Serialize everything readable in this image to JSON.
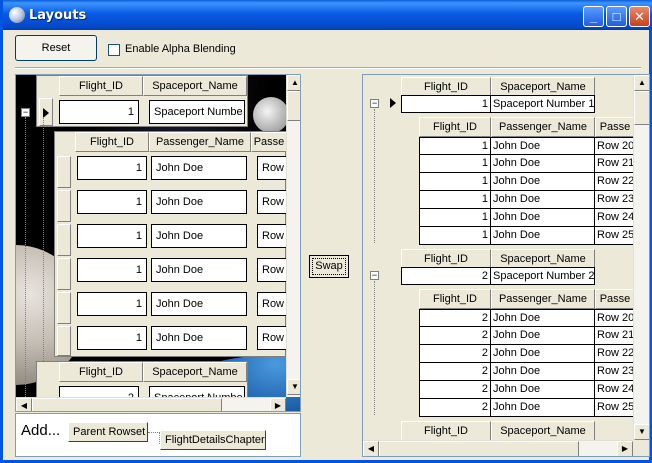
{
  "window": {
    "title": "Layouts",
    "minimize": "_",
    "maximize": "□",
    "close": "✕"
  },
  "toolbar": {
    "reset_label": "Reset",
    "alpha_label": "Enable Alpha Blending",
    "alpha_checked": false
  },
  "swap_label": "Swap",
  "add_area": {
    "label": "Add...",
    "parent_rowset": "Parent Rowset",
    "chapter": "FlightDetailsChapter"
  },
  "left": {
    "parent_headers": [
      "Flight_ID",
      "Spaceport_Name"
    ],
    "parent_row": {
      "flight_id": "1",
      "spaceport": "Spaceport Numbe"
    },
    "child_headers": [
      "Flight_ID",
      "Passenger_Name",
      "Passe"
    ],
    "child_rows": [
      {
        "flight_id": "1",
        "name": "John Doe",
        "row": "Row"
      },
      {
        "flight_id": "1",
        "name": "John Doe",
        "row": "Row"
      },
      {
        "flight_id": "1",
        "name": "John Doe",
        "row": "Row"
      },
      {
        "flight_id": "1",
        "name": "John Doe",
        "row": "Row"
      },
      {
        "flight_id": "1",
        "name": "John Doe",
        "row": "Row"
      },
      {
        "flight_id": "1",
        "name": "John Doe",
        "row": "Row"
      }
    ],
    "parent2_headers": [
      "Flight_ID",
      "Spaceport_Name"
    ],
    "parent2_row": {
      "flight_id": "2",
      "spaceport": "Spaceport Numbe"
    }
  },
  "right": {
    "group1": {
      "headers": [
        "Flight_ID",
        "Spaceport_Name"
      ],
      "row": {
        "flight_id": "1",
        "spaceport": "Spaceport Number 1"
      },
      "child_headers": [
        "Flight_ID",
        "Passenger_Name",
        "Passe"
      ],
      "child_rows": [
        {
          "flight_id": "1",
          "name": "John Doe",
          "row": "Row 20"
        },
        {
          "flight_id": "1",
          "name": "John Doe",
          "row": "Row 21"
        },
        {
          "flight_id": "1",
          "name": "John Doe",
          "row": "Row 22"
        },
        {
          "flight_id": "1",
          "name": "John Doe",
          "row": "Row 23"
        },
        {
          "flight_id": "1",
          "name": "John Doe",
          "row": "Row 24"
        },
        {
          "flight_id": "1",
          "name": "John Doe",
          "row": "Row 25"
        }
      ]
    },
    "group2": {
      "headers": [
        "Flight_ID",
        "Spaceport_Name"
      ],
      "row": {
        "flight_id": "2",
        "spaceport": "Spaceport Number 2"
      },
      "child_headers": [
        "Flight_ID",
        "Passenger_Name",
        "Passe"
      ],
      "child_rows": [
        {
          "flight_id": "2",
          "name": "John Doe",
          "row": "Row 20"
        },
        {
          "flight_id": "2",
          "name": "John Doe",
          "row": "Row 21"
        },
        {
          "flight_id": "2",
          "name": "John Doe",
          "row": "Row 22"
        },
        {
          "flight_id": "2",
          "name": "John Doe",
          "row": "Row 23"
        },
        {
          "flight_id": "2",
          "name": "John Doe",
          "row": "Row 24"
        },
        {
          "flight_id": "2",
          "name": "John Doe",
          "row": "Row 25"
        }
      ]
    },
    "group3": {
      "headers": [
        "Flight_ID",
        "Spaceport_Name"
      ]
    }
  }
}
